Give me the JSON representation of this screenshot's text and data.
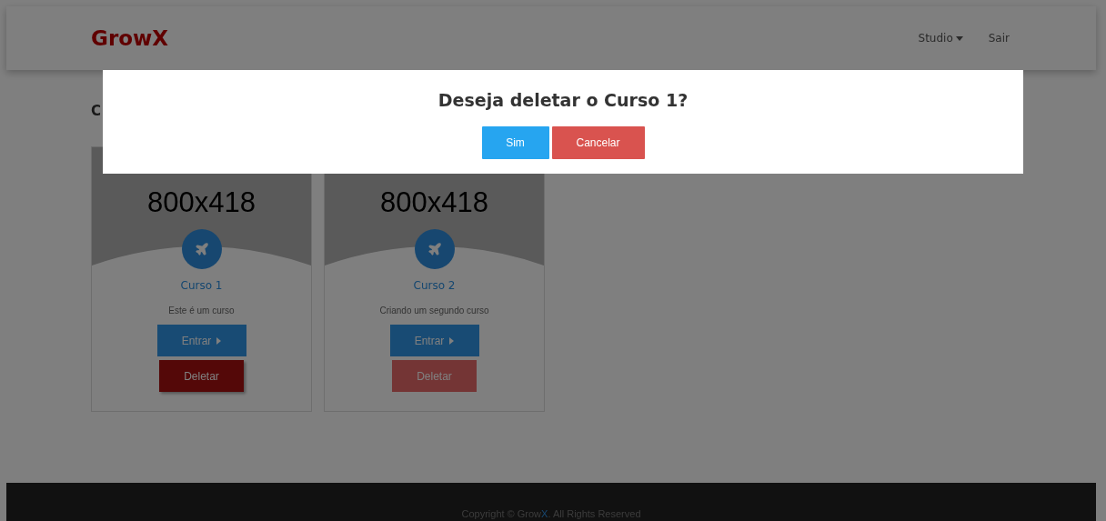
{
  "navbar": {
    "brand": "GrowX",
    "links": [
      {
        "label": "Studio",
        "dropdown": true
      },
      {
        "label": "Sair",
        "dropdown": false
      }
    ]
  },
  "page_heading": "C",
  "courses": [
    {
      "image_label": "800x418",
      "title": "Curso 1",
      "description": "Este é um curso",
      "enter_label": "Entrar",
      "delete_label": "Deletar",
      "delete_focused": true
    },
    {
      "image_label": "800x418",
      "title": "Curso 2",
      "description": "Criando um segundo curso",
      "enter_label": "Entrar",
      "delete_label": "Deletar",
      "delete_focused": false
    }
  ],
  "footer": {
    "text_before": "Copyright © Grow",
    "brand_mark": "X",
    "text_after": ". All Rights Reserved"
  },
  "modal": {
    "title": "Deseja deletar o Curso 1?",
    "buttons": [
      {
        "label": "Sim",
        "kind": "confirm"
      },
      {
        "label": "Cancelar",
        "kind": "cancel"
      }
    ]
  }
}
